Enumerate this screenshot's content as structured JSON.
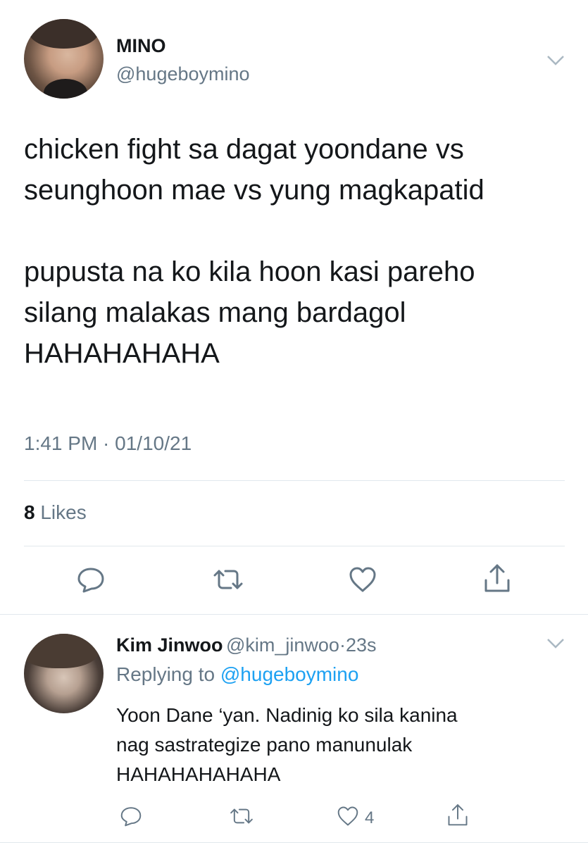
{
  "tweet": {
    "display_name": "MINO",
    "handle": "@hugeboymino",
    "text": "chicken fight sa dagat yoondane vs\nseunghoon mae vs yung magkapatid\n\npupusta na ko kila hoon kasi pareho\nsilang malakas mang bardagol\nHAHAHAHAHA",
    "timestamp": "1:41 PM · 01/10/21",
    "likes_count": "8",
    "likes_label": "Likes"
  },
  "reply": {
    "display_name": "Kim Jinwoo",
    "handle": "@kim_jinwoo",
    "separator": "·",
    "time": "23s",
    "replying_prefix": "Replying to",
    "replying_handle": "@hugeboymino",
    "text": "Yoon Dane ‘yan. Nadinig ko sila kanina\nnag sastrategize pano manunulak\nHAHAHAHAHAHA",
    "like_count": "4"
  },
  "icons": {
    "reply": "reply-icon",
    "retweet": "retweet-icon",
    "like": "heart-icon",
    "share": "share-icon",
    "menu": "chevron-down-icon"
  },
  "colors": {
    "text": "#14171a",
    "secondary": "#657786",
    "link": "#1da1f2",
    "divider": "#e1e8ed"
  }
}
